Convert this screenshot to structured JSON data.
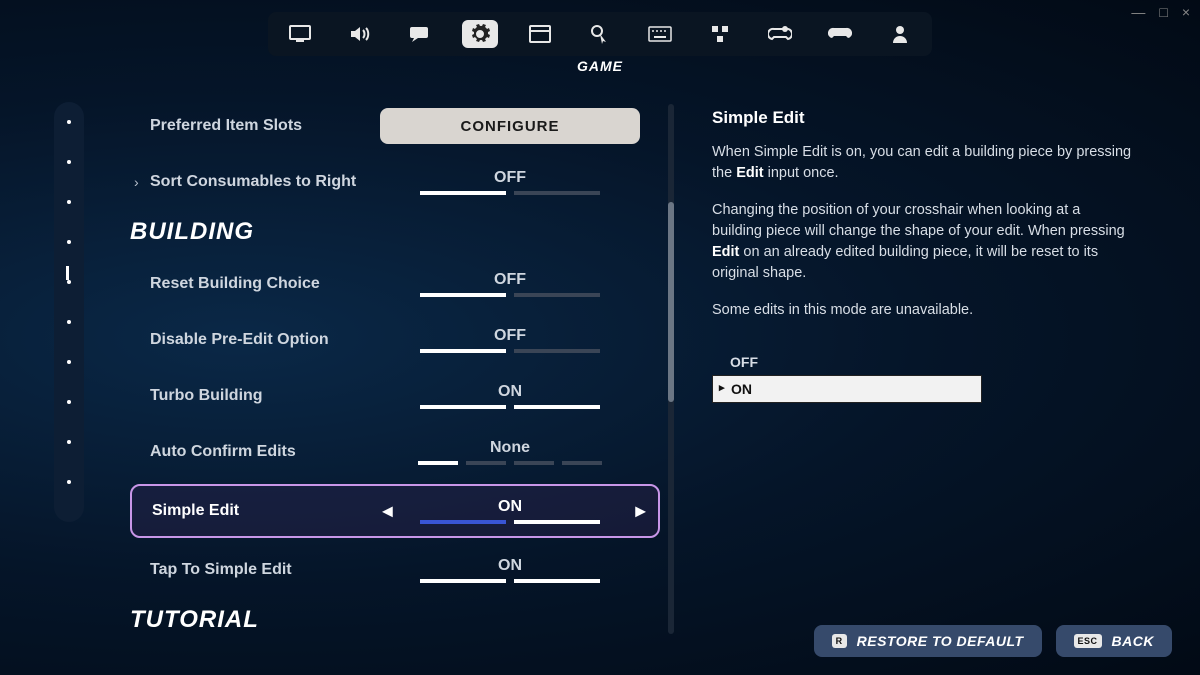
{
  "window": {
    "minimize": "—",
    "maximize": "□",
    "close": "×"
  },
  "topbar": {
    "icons": [
      "monitor",
      "volume",
      "chat",
      "gear",
      "browser",
      "touch",
      "keyboard",
      "accessibility",
      "gamepad-settings",
      "gamepad",
      "user"
    ],
    "active_index": 3,
    "label": "GAME"
  },
  "sections": {
    "building_header": "BUILDING",
    "tutorial_header": "TUTORIAL"
  },
  "settings": {
    "preferred_item_slots": {
      "label": "Preferred Item Slots",
      "button": "CONFIGURE"
    },
    "auto_sort": {
      "label": "Sort Consumables to Right",
      "value": "OFF",
      "filled": 1,
      "total": 2
    },
    "reset_building": {
      "label": "Reset Building Choice",
      "value": "OFF",
      "filled": 1,
      "total": 2
    },
    "disable_preedit": {
      "label": "Disable Pre-Edit Option",
      "value": "OFF",
      "filled": 1,
      "total": 2
    },
    "turbo_building": {
      "label": "Turbo Building",
      "value": "ON",
      "filled": 2,
      "total": 2
    },
    "auto_confirm": {
      "label": "Auto Confirm Edits",
      "value": "None",
      "filled": 1,
      "total": 4
    },
    "simple_edit": {
      "label": "Simple Edit",
      "value": "ON",
      "filled": 2,
      "total": 2,
      "selected": true
    },
    "tap_simple_edit": {
      "label": "Tap To Simple Edit",
      "value": "ON",
      "filled": 2,
      "total": 2
    }
  },
  "description": {
    "title": "Simple Edit",
    "p1a": "When Simple Edit is on, you can edit a building piece by pressing the ",
    "p1b": "Edit",
    "p1c": " input once.",
    "p2a": "Changing the position of your crosshair when looking at a building piece will change the shape of your edit. When pressing ",
    "p2b": "Edit",
    "p2c": " on an already edited building piece, it will be reset to its original shape.",
    "p3": "Some edits in this mode are unavailable.",
    "options": {
      "off": "OFF",
      "on": "ON"
    }
  },
  "buttons": {
    "restore": "RESTORE TO DEFAULT",
    "restore_key": "R",
    "back": "BACK",
    "back_key": "ESC"
  }
}
